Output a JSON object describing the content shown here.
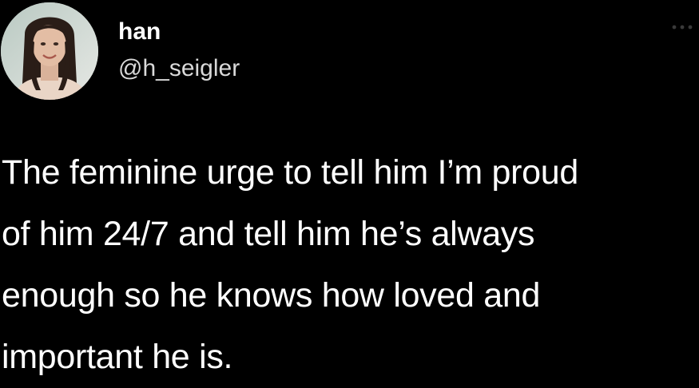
{
  "author": {
    "display_name": "han",
    "handle": "@h_seigler",
    "avatar_icon": "profile-photo-avatar"
  },
  "menu": {
    "icon": "more-options-icon"
  },
  "tweet": {
    "text": "The feminine urge to tell him I’m proud\nof him 24/7 and tell him he’s always\nenough so he knows how loved and\nimportant he is."
  },
  "colors": {
    "background": "#000000",
    "text": "#ffffff",
    "secondary_text": "#d9d9d9"
  }
}
